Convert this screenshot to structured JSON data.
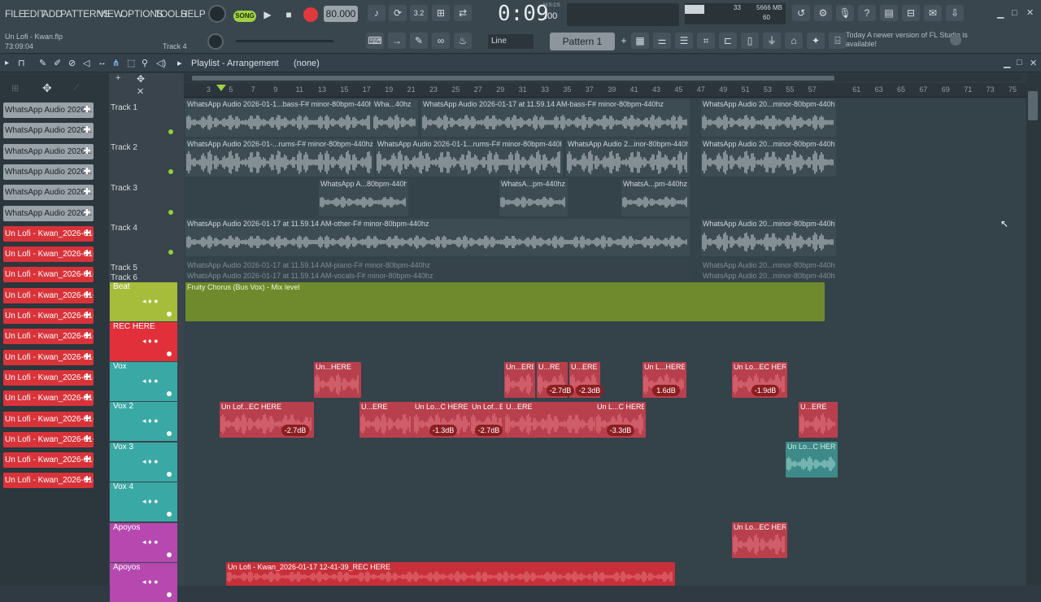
{
  "menu": [
    "FILE",
    "EDIT",
    "ADD",
    "PATTERNS",
    "VIEW",
    "OPTIONS",
    "TOOLS",
    "HELP"
  ],
  "transport": {
    "mode": "SONG",
    "tempo": "80.000",
    "time": "0:09",
    "time_small": ":00",
    "time_unit": "M:S:CS"
  },
  "cpu": {
    "mem": "5666 MB",
    "cpu": "33",
    "voices": "60"
  },
  "project": {
    "file": "Un Lofi - Kwan.flp",
    "position": "73:09:04",
    "track_hint": "Track 4"
  },
  "snap": "Line",
  "pattern": "Pattern 1",
  "hint": {
    "today": "Today",
    "msg": "A newer version of FL Studio is available!"
  },
  "playlist": {
    "title": "Playlist - Arrangement",
    "sel": "(none)"
  },
  "ruler": [
    "3",
    "5",
    "7",
    "9",
    "11",
    "13",
    "15",
    "17",
    "19",
    "21",
    "23",
    "25",
    "27",
    "29",
    "31",
    "33",
    "35",
    "37",
    "39",
    "41",
    "43",
    "45",
    "47",
    "49",
    "51",
    "53",
    "55",
    "57",
    "61",
    "63",
    "65",
    "67",
    "69",
    "71",
    "73",
    "75"
  ],
  "picker": [
    {
      "label": "WhatsApp Audio 2026...",
      "color": "g"
    },
    {
      "label": "WhatsApp Audio 2026...",
      "color": "g"
    },
    {
      "label": "WhatsApp Audio 2026...",
      "color": "g"
    },
    {
      "label": "WhatsApp Audio 2026...",
      "color": "g"
    },
    {
      "label": "WhatsApp Audio 2026...",
      "color": "g"
    },
    {
      "label": "WhatsApp Audio 2026...",
      "color": "g"
    },
    {
      "label": "Un Lofi - Kwan_2026-01-...",
      "color": "r"
    },
    {
      "label": "Un Lofi - Kwan_2026-01-...",
      "color": "r"
    },
    {
      "label": "Un Lofi - Kwan_2026-01-...",
      "color": "r"
    },
    {
      "label": "Un Lofi - Kwan_2026-01-...",
      "color": "r"
    },
    {
      "label": "Un Lofi - Kwan_2026-01-...",
      "color": "r"
    },
    {
      "label": "Un Lofi - Kwan_2026-01-...",
      "color": "r"
    },
    {
      "label": "Un Lofi - Kwan_2026-01-...",
      "color": "r"
    },
    {
      "label": "Un Lofi - Kwan_2026-01-...",
      "color": "r"
    },
    {
      "label": "Un Lofi - Kwan_2026-01-...",
      "color": "r"
    },
    {
      "label": "Un Lofi - Kwan_2026-01-...",
      "color": "r"
    },
    {
      "label": "Un Lofi - Kwan_2026-01-...",
      "color": "r"
    },
    {
      "label": "Un Lofi - Kwan_2026-01-...",
      "color": "r"
    },
    {
      "label": "Un Lofi - Kwan_2026-01-...",
      "color": "r"
    }
  ],
  "tracks": {
    "t1": "Track 1",
    "t2": "Track 2",
    "t3": "Track 3",
    "t4": "Track 4",
    "t5": "Track 5",
    "t6": "Track 6",
    "beat": "Beat",
    "rec": "REC HERE",
    "vox": "Vox",
    "vox2": "Vox 2",
    "vox3": "Vox 3",
    "vox4": "Vox 4",
    "apoyos": "Apoyos",
    "apoyos2": "Apoyos"
  },
  "clips": {
    "t1a": "WhatsApp Audio 2026-01-1...bass-F# minor-80bpm-440hz",
    "t1b": "Wha...40hz",
    "t1c": "WhatsApp Audio 2026-01-17 at 11.59.14 AM-bass-F# minor-80bpm-440hz",
    "t1d": "WhatsApp Audio 20...minor-80bpm-440hz",
    "t2a": "WhatsApp Audio 2026-01-...rums-F# minor-80bpm-440hz",
    "t2b": "WhatsApp Audio 2026-01-1...rums-F# minor-80bpm-440hz",
    "t2c": "WhatsApp Audio 2...inor-80bpm-440hz",
    "t2d": "WhatsApp Audio 20...minor-80bpm-440hz",
    "t3a": "WhatsApp A...80bpm-440hz",
    "t3b": "WhatsA...pm-440hz",
    "t3c": "WhatsA...pm-440hz",
    "t4a": "WhatsApp Audio 2026-01-17 at 11.59.14 AM-other-F# minor-80bpm-440hz",
    "t4b": "WhatsApp Audio 20...minor-80bpm-440hz",
    "t5a": "WhatsApp Audio 2026-01-17 at 11.59.14 AM-piano-F# minor-80bpm-440hz",
    "t5b": "WhatsApp Audio 20...minor-80bpm-440hz",
    "t6a": "WhatsApp Audio 2026-01-17 at 11.59.14 AM-vocals-F# minor-80bpm-440hz",
    "t6b": "WhatsApp Audio 20...minor-80bpm-440hz",
    "auto": "Fruity Chorus (Bus Vox) - Mix level",
    "v1": "Un...HERE",
    "v2": "Un...ERE",
    "v3": "U...RE",
    "v4": "U...ERE",
    "v5": "Un L...HERE",
    "v6": "Un Lo...EC HERE",
    "v21": "Un Lof...EC HERE",
    "v22": "U...ERE",
    "v23": "Un Lo...C HERE",
    "v24": "Un Lof...EC HERE",
    "v25": "U...ERE",
    "v26": "Un L...C HERE",
    "v27": "U...ERE",
    "v31": "Un Lo...C HERE",
    "ap1": "Un Lo...EC HERE",
    "ap2": "Un Lofi - Kwan_2026-01-17 12-41-39_REC HERE"
  },
  "gains": {
    "g1": "-2.7dB",
    "g2": "-2.3dB",
    "g3": "1.6dB",
    "g4": "-1.9dB",
    "g5": "-2.7dB",
    "g6": "-1.3dB",
    "g7": "-2.7dB",
    "g8": "-3.3dB"
  },
  "colors": {
    "green": "#a5bd3a",
    "red": "#e2303a",
    "teal": "#3aa9a5",
    "pink": "#e65f6d",
    "magenta": "#b648b0",
    "clip_pink": "#b8404d"
  }
}
